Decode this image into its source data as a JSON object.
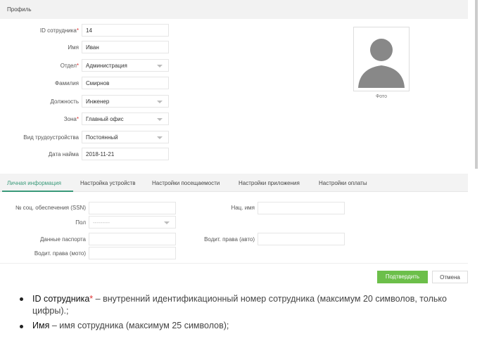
{
  "header": {
    "title": "Профиль"
  },
  "profile": {
    "fields": [
      {
        "label": "ID сотрудника",
        "required": true,
        "value": "14",
        "type": "text"
      },
      {
        "label": "Имя",
        "required": false,
        "value": "Иван",
        "type": "text"
      },
      {
        "label": "Отдел",
        "required": true,
        "value": "Администрация",
        "type": "select"
      },
      {
        "label": "Фамилия",
        "required": false,
        "value": "Смирнов",
        "type": "text"
      },
      {
        "label": "Должность",
        "required": false,
        "value": "Инженер",
        "type": "select"
      },
      {
        "label": "Зона",
        "required": true,
        "value": "Главный офис",
        "type": "select"
      },
      {
        "label": "Вид трудоустройства",
        "required": false,
        "value": "Постоянный",
        "type": "select"
      },
      {
        "label": "Дата найма",
        "required": false,
        "value": "2018-11-21",
        "type": "text"
      }
    ],
    "photo_label": "Фото",
    "required_mark": "*"
  },
  "tabs": [
    "Личная информация",
    "Настройка устройств",
    "Настройки посещаемости",
    "Настройки приложения",
    "Настройки оплаты"
  ],
  "personal": {
    "ssn_label": "№ соц. обеспечения (SSN)",
    "nat_name_label": "Нац. имя",
    "gender_label": "Пол",
    "gender_value": "---------",
    "passport_label": "Данные паспорта",
    "car_license_label": "Водит. права (авто)",
    "moto_license_label": "Водит. права (мото)"
  },
  "buttons": {
    "confirm": "Подтвердить",
    "cancel": "Отмена",
    "confirm_color": "#6cbf4a"
  },
  "notes": [
    {
      "term": "ID сотрудника",
      "mark": "*",
      "text": " – внутренний идентификационный номер сотрудника (максимум 20 символов, только цифры).;"
    },
    {
      "term": "Имя",
      "mark": "",
      "text": " – имя сотрудника (максимум 25 символов);"
    }
  ]
}
